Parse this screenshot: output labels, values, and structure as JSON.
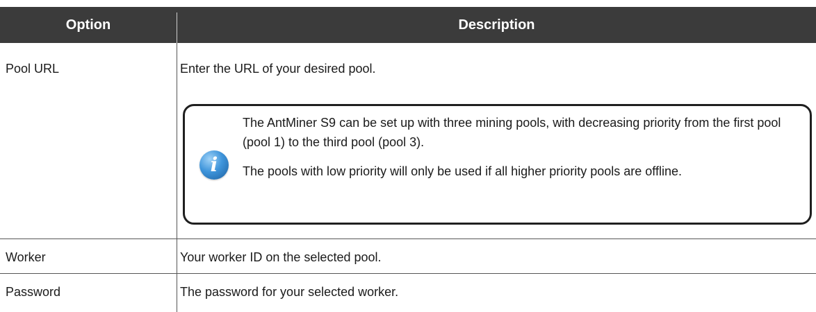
{
  "table": {
    "headers": {
      "option": "Option",
      "description": "Description"
    },
    "rows": [
      {
        "option": "Pool URL",
        "description": "Enter the URL of your desired pool.",
        "note": {
          "icon": "info-icon",
          "paragraphs": [
            "The AntMiner S9 can be set up with three mining pools, with decreasing priority from the first pool (pool 1) to the third pool (pool 3).",
            "The pools with low priority will only be used if all higher priority pools are offline."
          ]
        }
      },
      {
        "option": "Worker",
        "description": "Your worker ID on the selected pool."
      },
      {
        "option": "Password",
        "description": "The password for your selected worker."
      }
    ]
  },
  "colors": {
    "header_background": "#3b3b3b",
    "header_text": "#ffffff",
    "border": "#555555",
    "info_icon": "#3f95db"
  }
}
